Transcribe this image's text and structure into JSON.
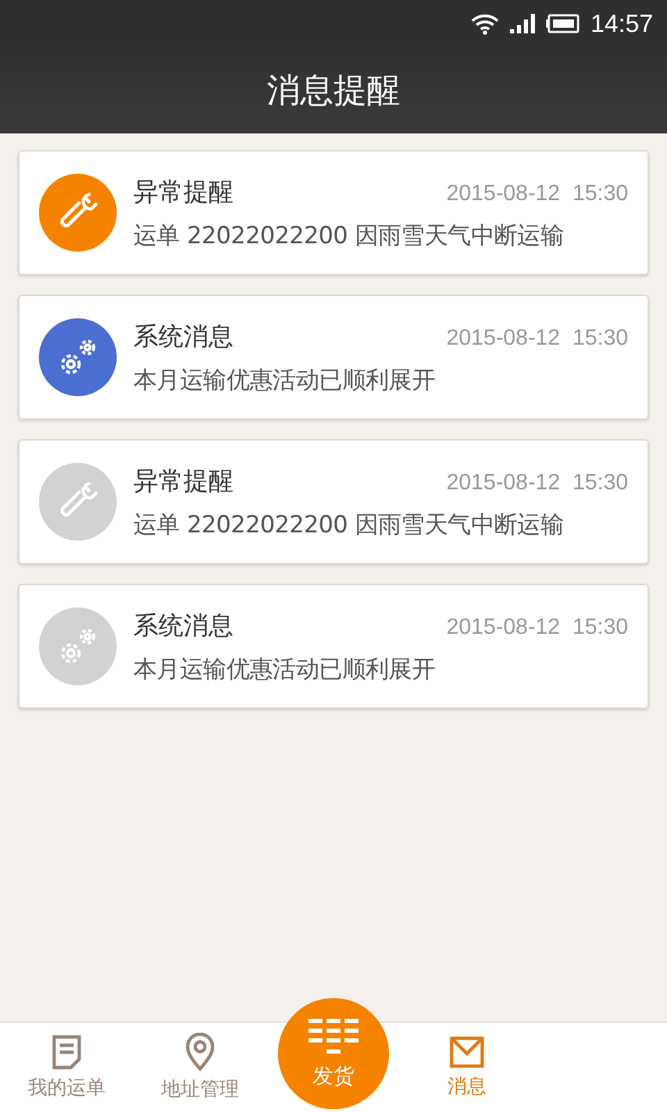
{
  "status_bar": {
    "time": "14:57"
  },
  "header": {
    "title": "消息提醒"
  },
  "messages": [
    {
      "kind": "wrench",
      "title": "异常提醒",
      "time": "2015-08-12  15:30",
      "text": "运单 22022022200 因雨雪天气中断运输",
      "color": "#f58300"
    },
    {
      "kind": "gears",
      "title": "系统消息",
      "time": "2015-08-12  15:30",
      "text": "本月运输优惠活动已顺利展开",
      "color": "#4a6fd0"
    },
    {
      "kind": "wrench",
      "title": "异常提醒",
      "time": "2015-08-12  15:30",
      "text": "运单 22022022200 因雨雪天气中断运输",
      "color": "#d2d2d2"
    },
    {
      "kind": "gears",
      "title": "系统消息",
      "time": "2015-08-12  15:30",
      "text": "本月运输优惠活动已顺利展开",
      "color": "#d2d2d2"
    }
  ],
  "bottom_nav": [
    {
      "kind": "doc",
      "label": "我的运单",
      "selected": false
    },
    {
      "kind": "pin",
      "label": "地址管理",
      "selected": false
    },
    {
      "kind": "center",
      "label": "发货",
      "selected": false
    },
    {
      "kind": "mail",
      "label": "消息",
      "selected": true
    }
  ]
}
